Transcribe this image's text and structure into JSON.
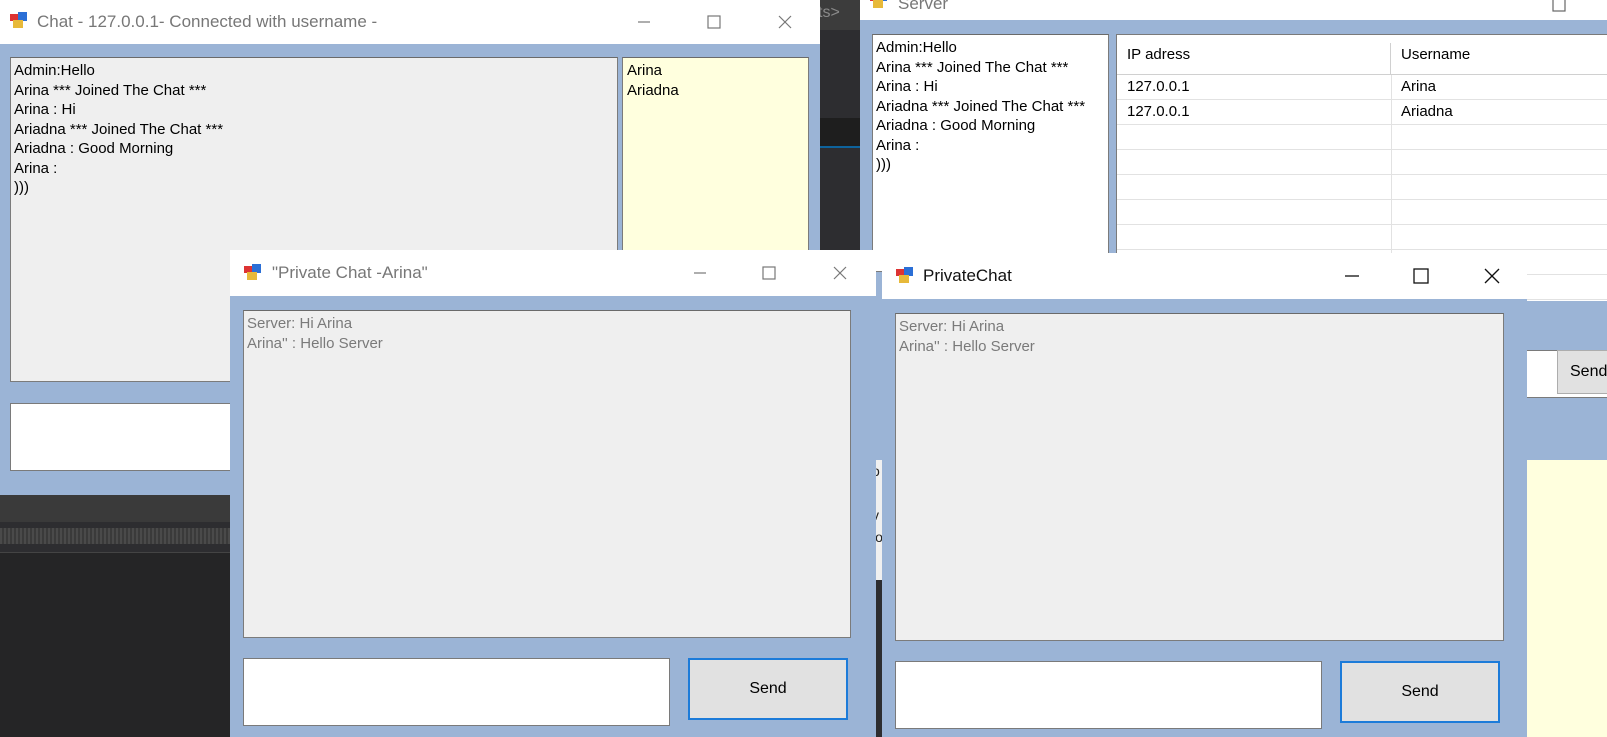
{
  "chat_window": {
    "title": "Chat - 127.0.0.1- Connected with username -",
    "messages": [
      "Admin:Hello",
      "Arina *** Joined The Chat ***",
      "Arina : Hi",
      "Ariadna *** Joined The Chat ***",
      "Ariadna : Good Morning",
      "Arina :",
      ")))"
    ],
    "users": [
      "Arina",
      "Ariadna"
    ],
    "message_input_value": ""
  },
  "server_window": {
    "title": "Server",
    "messages": [
      "Admin:Hello",
      "Arina *** Joined The Chat ***",
      "Arina : Hi",
      "Ariadna *** Joined The Chat ***",
      "Ariadna : Good Morning",
      "Arina :",
      ")))"
    ],
    "grid": {
      "columns": [
        "IP adress",
        "Username"
      ],
      "rows": [
        [
          "127.0.0.1",
          "Arina"
        ],
        [
          "127.0.0.1",
          "Ariadna"
        ]
      ]
    },
    "send_label": "Send"
  },
  "private_chat_left": {
    "title": "\"Private Chat -Arina\"",
    "messages": [
      "Server: Hi Arina",
      "Arina'' : Hello Server"
    ],
    "send_label": "Send"
  },
  "private_chat_right": {
    "title": "PrivateChat",
    "messages": [
      "Server: Hi Arina",
      "Arina'' : Hello Server"
    ],
    "send_label": "Send"
  },
  "background_ide": {
    "fragment_text": "cts>",
    "fragment_letters": [
      "o",
      "i",
      "v",
      "io"
    ]
  },
  "colors": {
    "window_client": "#9bb4d6",
    "textbox_bg": "#efefef",
    "userlist_bg": "#ffffde",
    "send_border": "#1c7bd9",
    "ide_bg": "#2b2b2b"
  },
  "icons": [
    "app-icon",
    "minimize-icon",
    "maximize-icon",
    "close-icon"
  ]
}
